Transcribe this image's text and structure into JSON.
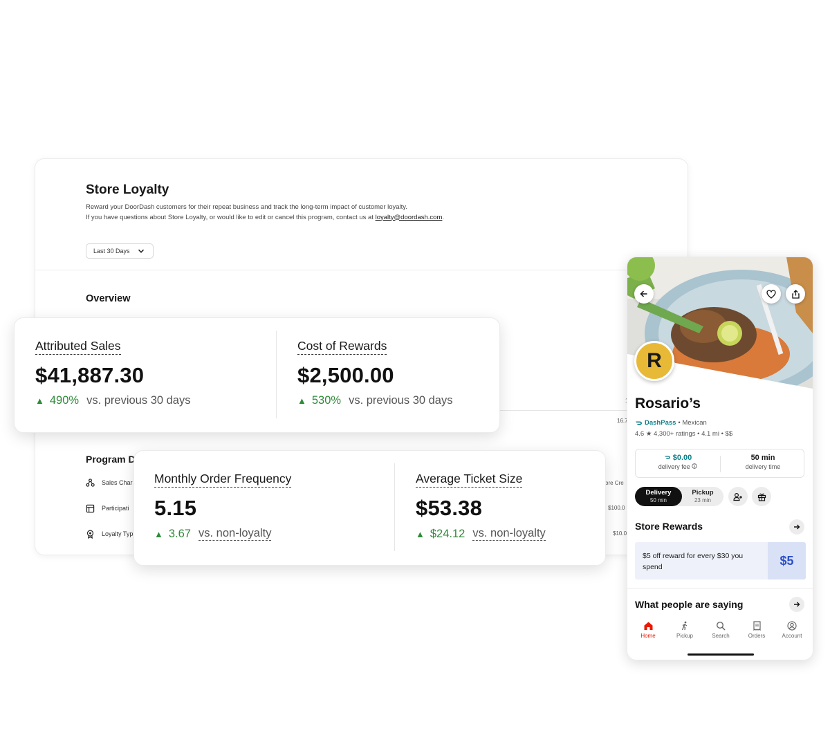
{
  "dashboard": {
    "title": "Store Loyalty",
    "description_line1": "Reward your DoorDash customers for their repeat business and track the long-term impact of customer loyalty.",
    "description_line2_prefix": "If you have questions about Store Loyalty, or would like to edit or cancel this program, contact us at ",
    "contact_email": "loyalty@doordash.com",
    "description_line2_suffix": ".",
    "date_range": "Last 30 Days",
    "overview_title": "Overview",
    "peek_values": [
      "1",
      "16.7",
      "ore Cre",
      "$100.0",
      "$10.0"
    ],
    "program_title": "Program D",
    "program_rows": [
      {
        "label": "Sales Char",
        "icon": "sales-channel-icon"
      },
      {
        "label": "Participati",
        "icon": "store-icon"
      },
      {
        "label": "Loyalty Typ",
        "icon": "badge-icon"
      }
    ]
  },
  "metrics": [
    {
      "label": "Attributed Sales",
      "value": "$41,887.30",
      "delta": "490%",
      "comparison": "vs. previous 30 days"
    },
    {
      "label": "Cost of Rewards",
      "value": "$2,500.00",
      "delta": "530%",
      "comparison": "vs. previous 30 days"
    },
    {
      "label": "Monthly Order Frequency",
      "value": "5.15",
      "delta": "3.67",
      "comparison": "vs. non-loyalty"
    },
    {
      "label": "Average Ticket Size",
      "value": "$53.38",
      "delta": "$24.12",
      "comparison": "vs. non-loyalty"
    }
  ],
  "phone": {
    "logo_letter": "R",
    "store_name": "Rosario’s",
    "dashpass": "DashPass",
    "cuisine": "• Mexican",
    "rating_line": "4.6 ★ 4,300+ ratings • 4.1 mi • $$",
    "delivery_fee_value": "$0.00",
    "delivery_fee_label": "delivery fee",
    "delivery_time_value": "50 min",
    "delivery_time_label": "delivery time",
    "toggle": {
      "delivery_label": "Delivery",
      "delivery_time": "50 min",
      "pickup_label": "Pickup",
      "pickup_time": "23 min"
    },
    "rewards_title": "Store Rewards",
    "reward_text": "$5 off reward for every $30 you spend",
    "reward_amount": "$5",
    "reviews_title": "What people are saying",
    "tabs": [
      "Home",
      "Pickup",
      "Search",
      "Orders",
      "Account"
    ]
  },
  "colors": {
    "positive": "#2f8a3a",
    "brand_red": "#eb1700",
    "reward_blue": "#2c4fc9",
    "dashpass_teal": "#0e7f8a"
  }
}
